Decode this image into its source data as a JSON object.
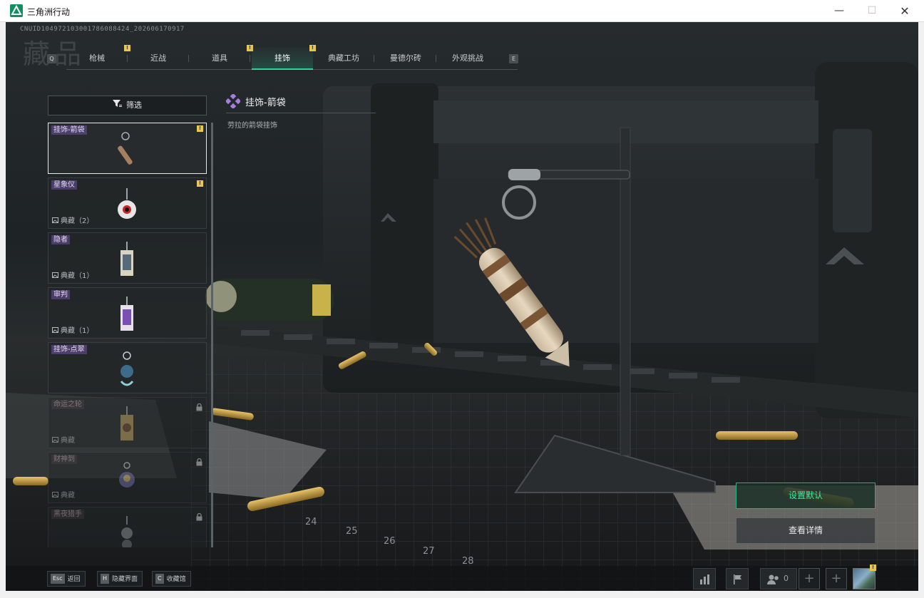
{
  "window": {
    "title": "三角洲行动",
    "minimize": "—",
    "maximize": "☐",
    "close": "✕"
  },
  "uid": "CNUID1049721030017860884​24_202606170917",
  "page_title": "藏品",
  "tabs": {
    "key_prev": "Q",
    "key_next": "E",
    "items": [
      {
        "label": "枪械",
        "badge": "!"
      },
      {
        "label": "近战",
        "badge": ""
      },
      {
        "label": "道具",
        "badge": "!"
      },
      {
        "label": "挂饰",
        "badge": "!"
      },
      {
        "label": "典藏工坊",
        "badge": ""
      },
      {
        "label": "曼德尔砖",
        "badge": ""
      },
      {
        "label": "外观挑战",
        "badge": ""
      }
    ]
  },
  "filter": {
    "label": "筛选"
  },
  "list": [
    {
      "name": "挂饰-箭袋",
      "badge": "!",
      "collection": "",
      "locked": false,
      "selected": true
    },
    {
      "name": "星象仪",
      "badge": "!",
      "collection": "典藏（2）",
      "locked": false,
      "selected": false
    },
    {
      "name": "隐者",
      "badge": "",
      "collection": "典藏（1）",
      "locked": false,
      "selected": false
    },
    {
      "name": "审判",
      "badge": "",
      "collection": "典藏（1）",
      "locked": false,
      "selected": false
    },
    {
      "name": "挂饰-点翠",
      "badge": "",
      "collection": "",
      "locked": false,
      "selected": false
    },
    {
      "name": "命运之轮",
      "badge": "",
      "collection": "典藏",
      "locked": true,
      "selected": false
    },
    {
      "name": "财神到",
      "badge": "",
      "collection": "典藏",
      "locked": true,
      "selected": false
    },
    {
      "name": "黑夜猎手",
      "badge": "",
      "collection": "",
      "locked": true,
      "selected": false
    }
  ],
  "detail": {
    "title": "挂饰-箭袋",
    "description": "劳拉的箭袋挂饰"
  },
  "actions": {
    "set_default": "设置默认",
    "view_details": "查看详情"
  },
  "bottom_hints": [
    {
      "key": "Esc",
      "label": "返回"
    },
    {
      "key": "H",
      "label": "隐藏界面"
    },
    {
      "key": "C",
      "label": "收藏馆"
    }
  ],
  "friends_count": "0",
  "avatar_badge": "!",
  "plus_slots": [
    "+",
    "+"
  ],
  "ruler_numbers": [
    "24",
    "25",
    "26",
    "27",
    "28"
  ],
  "colors": {
    "accent": "#2fd39a",
    "badge": "#e7c84a",
    "name_tag": "#6e50a0"
  },
  "icons": {
    "filter": "filter-icon",
    "lock": "lock-icon",
    "collection": "image-icon",
    "chart": "chart-icon",
    "flag": "flag-icon",
    "friends": "friends-icon",
    "rarity": "diamond-icon"
  }
}
